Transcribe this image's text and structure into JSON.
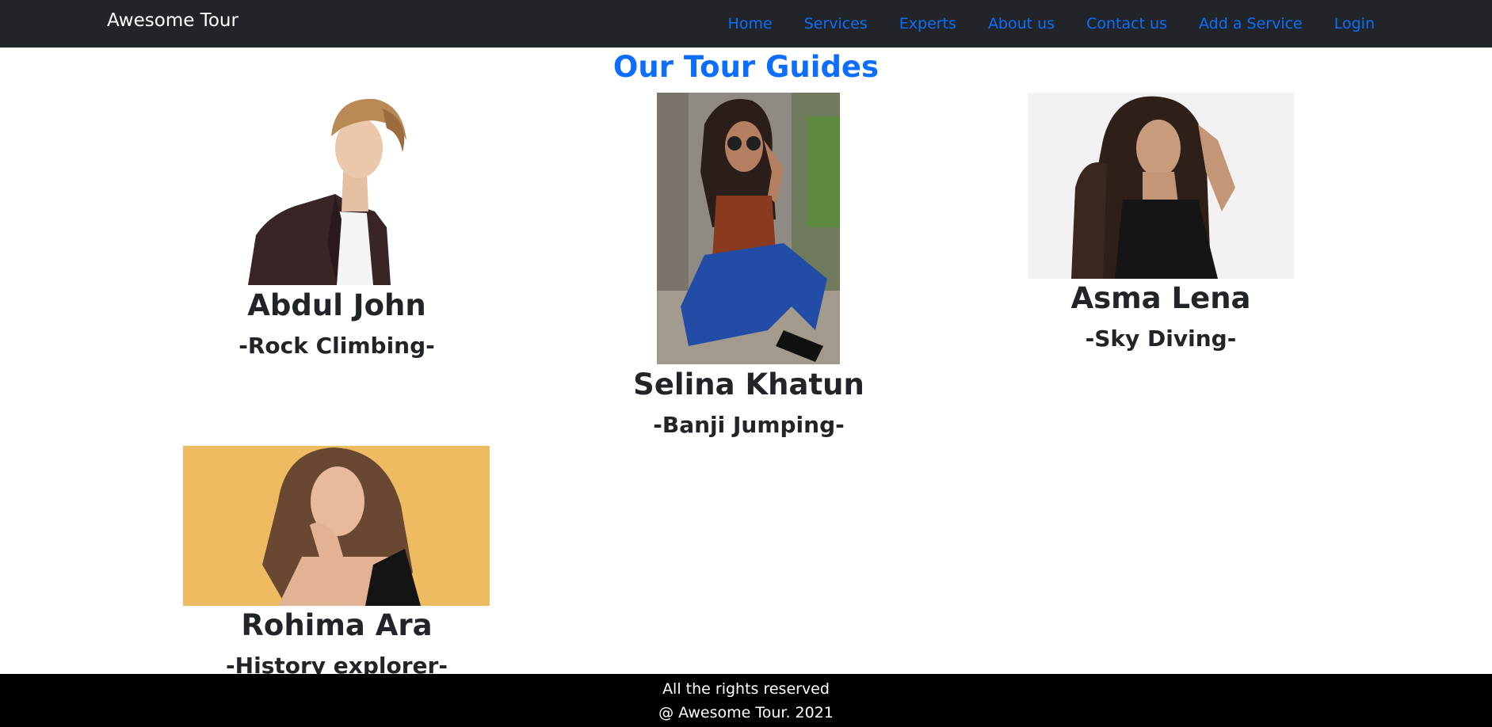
{
  "navbar": {
    "brand": "Awesome Tour",
    "links": [
      "Home",
      "Services",
      "Experts",
      "About us",
      "Contact us",
      "Add a Service",
      "Login"
    ],
    "link_color": "#0d6efd",
    "background": "#212529"
  },
  "main": {
    "title": "Our Tour Guides",
    "guides": [
      {
        "name": "Abdul John",
        "specialty": "-Rock Climbing-"
      },
      {
        "name": "Selina Khatun",
        "specialty": "-Banji Jumping-"
      },
      {
        "name": "Asma Lena",
        "specialty": "-Sky Diving-"
      },
      {
        "name": "Rohima Ara",
        "specialty": "-History explorer-"
      }
    ]
  },
  "footer": {
    "line1": "All the rights reserved",
    "line2": "@ Awesome Tour. 2021"
  }
}
